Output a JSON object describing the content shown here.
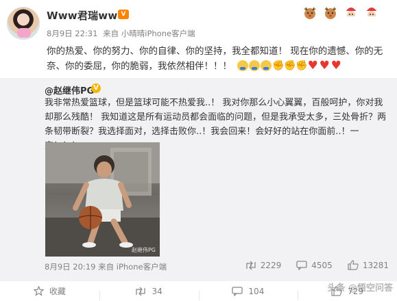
{
  "post": {
    "username": "Www君瑞wwW",
    "badge_text": "V",
    "timestamp": "8月9日 22:31",
    "source": "来自 小晴晴iPhone客户端",
    "text": "你的热爱、你的努力、你的自律、你的坚持，我全都知道！ 现在你的遗憾、你的无奈、你的委屈，你的脆弱，我依然相伴！！！",
    "emojis": [
      "hug",
      "hug",
      "hug",
      "muscle",
      "muscle",
      "muscle",
      "heart",
      "heart",
      "heart"
    ],
    "decorations": [
      "deer-icon",
      "deer-icon",
      "santa-icon",
      "santa-icon"
    ]
  },
  "repost": {
    "username": "@赵继伟PG",
    "verified_badge": "V",
    "text": "我非常热爱篮球，但是篮球可能不热爱我..！ 我对你那么小心翼翼，百般呵护，你对我却那么残酷！ 我知道这是所有运动员都会面临的问题，但是我承受太多，三处骨折？两条韧带断裂？我选择面对，选择击败你..！我会回来！会好好的站在你面前..！一定！！！",
    "photo_watermark": "赵继伟PG",
    "timestamp": "8月9日 20:19",
    "source": "来自 iPhone客户端",
    "stats": {
      "reposts": "2229",
      "comments": "4505",
      "likes": "13281"
    }
  },
  "footer": {
    "favorite_label": "收藏",
    "repost_count": "34",
    "comment_count": "104",
    "like_count": "729"
  },
  "site_watermark": "头条 @悟空问答",
  "colors": {
    "accent_orange": "#ff8200",
    "verified_gold": "#f7b500",
    "repost_bg": "#f2f2f5",
    "meta_gray": "#808080"
  }
}
